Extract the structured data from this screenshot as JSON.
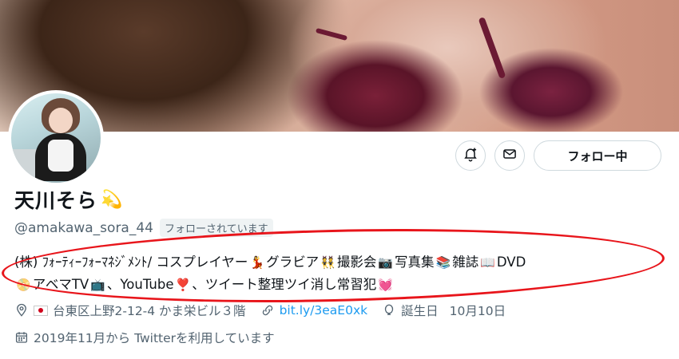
{
  "profile": {
    "display_name": "天川そら",
    "name_emoji": "💫",
    "handle": "@amakawa_sora_44",
    "follows_you": "フォローされています",
    "follow_button": "フォロー中",
    "bio_line1_text1": "(株) ﾌｫｰﾃｨｰﾌｫｰﾏﾈｼﾞﾒﾝﾄ/ コスプレイヤー",
    "bio_line1_text2": "グラビア",
    "bio_line1_text3": "撮影会",
    "bio_line1_text4": "写真集",
    "bio_line1_text5": "雑誌",
    "bio_line1_text6": "DVD",
    "bio_line2_text1": "アベマTV",
    "bio_line2_text2": "、YouTube",
    "bio_line2_text3": "、ツイート整理ツイ消し常習犯",
    "emoji_dancer": "💃",
    "emoji_bunny": "👯",
    "emoji_camera": "📷",
    "emoji_books": "📚",
    "emoji_book": "📖",
    "emoji_dvd": "📀",
    "emoji_tv": "📺",
    "emoji_heart_ex": "❣️",
    "emoji_heart": "💓",
    "location": "台東区上野2-12-4 かま栄ビル３階",
    "link_text": "bit.ly/3eaE0xk",
    "birthday_label": "誕生日",
    "birthday": "10月10日",
    "joined": "2019年11月から Twitterを利用しています"
  },
  "colors": {
    "link": "#1d9bf0",
    "secondary_text": "#536471",
    "annotation_red": "#e8151b"
  }
}
